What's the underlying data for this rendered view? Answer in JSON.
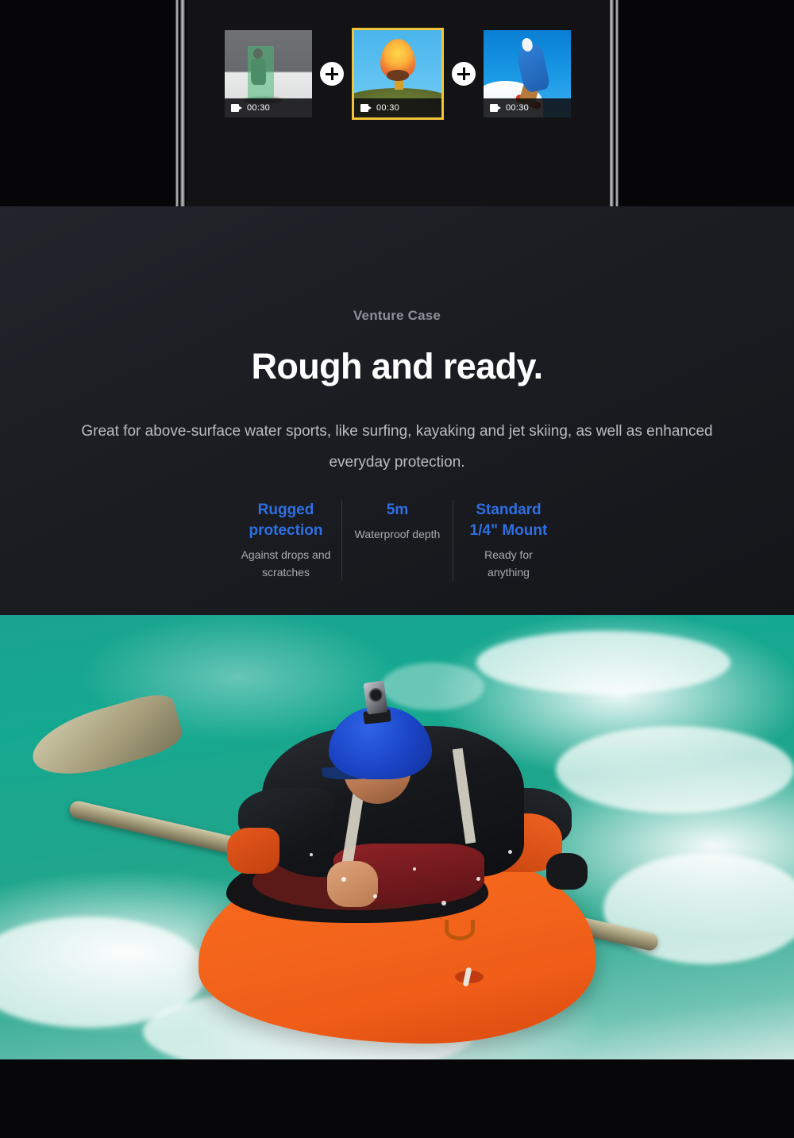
{
  "clip_strip": {
    "clips": [
      {
        "duration": "00:30",
        "icon": "video-camera-icon",
        "scene": "grayscale-snowboarder-with-green-tracking-box",
        "selected": false
      },
      {
        "duration": "00:30",
        "icon": "video-camera-icon",
        "scene": "hot-air-balloon-over-hill",
        "selected": true
      },
      {
        "duration": "00:30",
        "icon": "video-camera-icon",
        "scene": "snowboarder-jumping-blue-sky",
        "selected": false
      }
    ],
    "add_buttons": [
      {
        "label": "+",
        "name": "add-clip-button-1"
      },
      {
        "label": "+",
        "name": "add-clip-button-2"
      }
    ],
    "selection_color": "#f2c438"
  },
  "copy": {
    "eyebrow": "Venture Case",
    "headline": "Rough and ready.",
    "body": "Great for above-surface water sports, like surfing, kayaking and jet skiing, as well as enhanced everyday protection.",
    "accent_color": "#2f6fe4",
    "headline_color": "#ffffff",
    "eyebrow_color": "#8d9098"
  },
  "stats": [
    {
      "value": "Rugged protection",
      "label": "Against drops and scratches"
    },
    {
      "value": "5m",
      "label": "Waterproof depth"
    },
    {
      "value": "Standard 1/4\" Mount",
      "label": "Ready for anything"
    }
  ],
  "photo": {
    "alt": "kayaker-in-whitewater-with-action-camera-on-helmet",
    "helmet_color": "#1b45c6",
    "kayak_color": "#f4651c",
    "water_color": "#15a890"
  }
}
